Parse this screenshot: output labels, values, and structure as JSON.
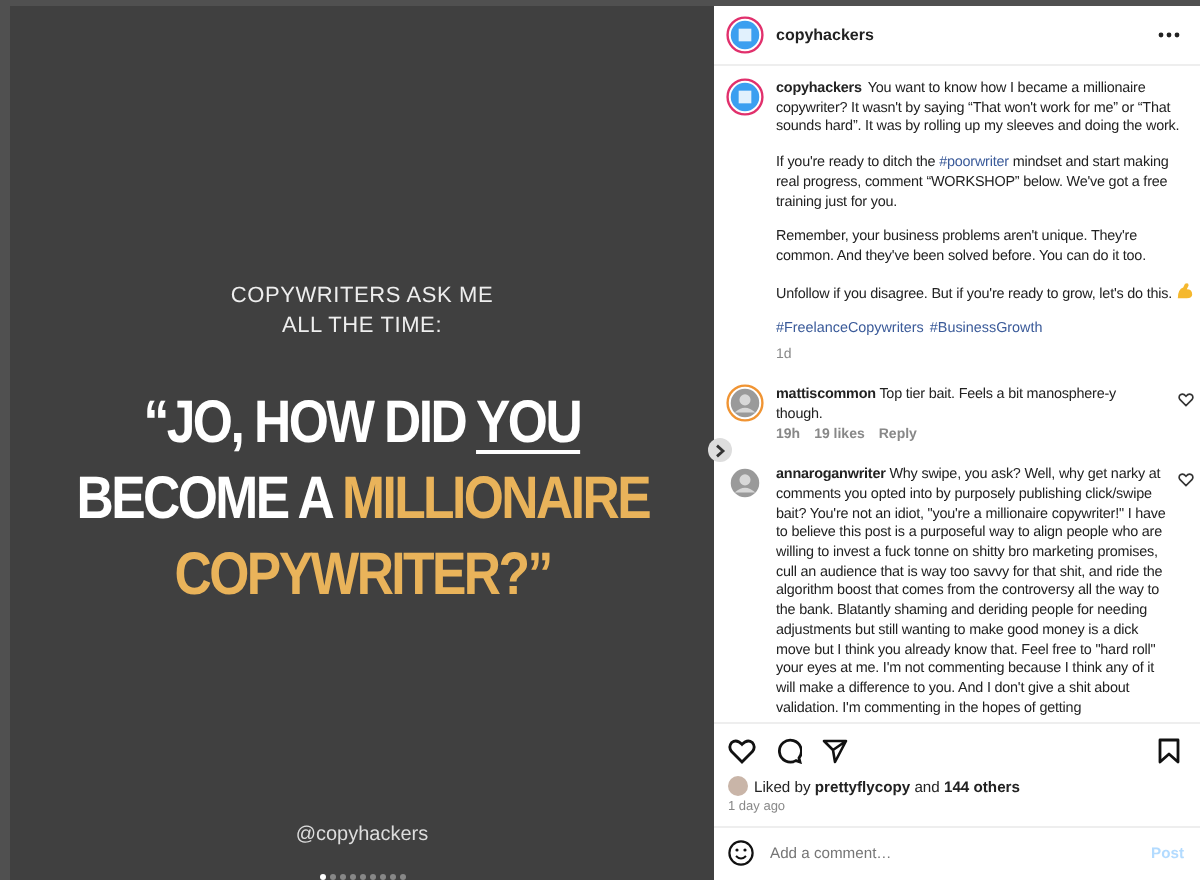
{
  "post_image": {
    "kicker": [
      "COPYWRITERS ASK ME",
      "ALL THE TIME:"
    ],
    "headline": [
      [
        {
          "text": "“JO, HOW DID ",
          "kind": "plain"
        },
        {
          "text": "YOU",
          "kind": "underline"
        }
      ],
      [
        {
          "text": "BECOME A ",
          "kind": "plain"
        },
        {
          "text": "MILLIONAIRE",
          "kind": "accent"
        }
      ],
      [
        {
          "text": "COPYWRITER?”",
          "kind": "accent"
        }
      ]
    ],
    "handle": "@copyhackers",
    "dots": [
      {
        "selected": true
      },
      {
        "selected": false
      },
      {
        "selected": false
      },
      {
        "selected": false
      },
      {
        "selected": false
      },
      {
        "selected": false
      },
      {
        "selected": false
      },
      {
        "selected": false
      },
      {
        "selected": false
      }
    ]
  },
  "header": {
    "username": "copyhackers"
  },
  "caption": {
    "username": "copyhackers",
    "paragraphs": [
      [
        {
          "text": "You want to know how I became a millionaire copywriter? It wasn't by saying “That won't work for me” or “That sounds hard”. It was by rolling up my sleeves and doing the work.",
          "kind": "text"
        }
      ],
      [
        {
          "text": "If you're ready to ditch the ",
          "kind": "text"
        },
        {
          "text": "#poorwriter",
          "kind": "tag"
        },
        {
          "text": " mindset and start making real progress, comment “WORKSHOP” below. We've got a free training just for you.",
          "kind": "text"
        }
      ],
      [
        {
          "text": "Remember, your business problems aren't unique. They're common. And they've been solved before. You can do it too.",
          "kind": "text"
        }
      ],
      [
        {
          "text": "Unfollow if you disagree. But if you're ready to grow, let's do this.",
          "kind": "text"
        },
        {
          "kind": "flex"
        }
      ]
    ],
    "hashtags": [
      "#FreelanceCopywriters",
      "#BusinessGrowth"
    ],
    "time": "1d"
  },
  "comments": [
    {
      "username": "mattiscommon",
      "text": "Top tier bait. Feels a bit manosphere-y though.",
      "time": "19h",
      "likes": "19 likes",
      "reply": "Reply",
      "story_ring": true
    },
    {
      "username": "annaroganwriter",
      "text": "Why swipe, you ask? Well, why get narky at comments you opted into by purposely publishing click/swipe bait? You're not an idiot, \"you're a millionaire copywriter!\" I have to believe this post is a purposeful way to align people who are willing to invest a fuck tonne on shitty bro marketing promises, cull an audience that is way too savvy for that shit, and ride the algorithm boost that comes from the controversy all the way to the bank. Blatantly shaming and deriding people for needing adjustments but still wanting to make good money is a dick move but I think you already know that. Feel free to \"hard roll\" your eyes at me. I'm not commenting because I think any of it will make a difference to you. And I don't give a shit about validation. I'm commenting in the hopes of getting",
      "story_ring": false
    }
  ],
  "likes": {
    "prefix": "Liked by ",
    "user": "prettyflycopy",
    "middle": " and ",
    "count": "144 others"
  },
  "posted": "1 day ago",
  "add_comment": {
    "placeholder": "Add a comment…",
    "post": "Post",
    "post_disabled": true
  }
}
